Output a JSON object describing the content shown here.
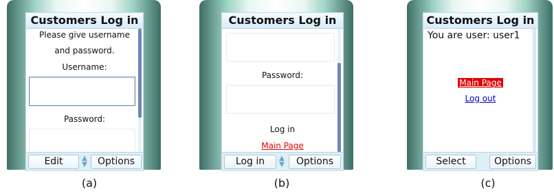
{
  "panels": [
    {
      "title": "Customers Log in",
      "lines": [
        "Please give username",
        "and password.",
        "Username:",
        "Password:"
      ],
      "softkeys": {
        "left": "Edit",
        "right": "Options"
      },
      "caption": "(a)"
    },
    {
      "title": "Customers Log in",
      "lines": [
        "Password:",
        "Log in"
      ],
      "link_main_page": "Main Page",
      "softkeys": {
        "left": "Log in",
        "right": "Options"
      },
      "caption": "(b)"
    },
    {
      "title": "Customers Log in",
      "user_text": "You are user: user1",
      "link_main_page": "Main Page",
      "link_logout": "Log out",
      "softkeys": {
        "left": "Select",
        "right": "Options"
      },
      "caption": "(c)"
    }
  ],
  "colors": {
    "link_red": "#e40000",
    "link_blue": "#0000cc",
    "titlebar": "#d8ecf8",
    "focus_border": "#6b89b8"
  }
}
